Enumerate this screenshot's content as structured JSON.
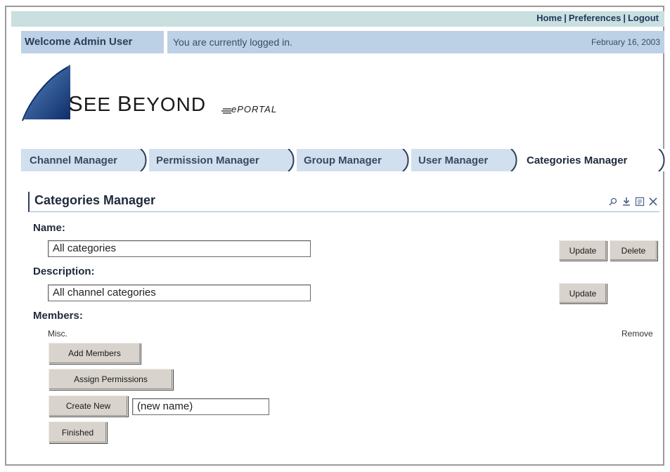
{
  "header": {
    "links": [
      "Home",
      "Preferences",
      "Logout"
    ],
    "separator": "|",
    "welcome": "Welcome Admin User",
    "status": "You are currently logged in.",
    "date": "February 16, 2003"
  },
  "logo": {
    "brand_first": "S",
    "brand_rest1": "EE ",
    "brand_b": "B",
    "brand_rest2": "EYOND",
    "product": "ePORTAL"
  },
  "tabs": [
    {
      "label": "Channel Manager"
    },
    {
      "label": "Permission Manager"
    },
    {
      "label": "Group Manager"
    },
    {
      "label": "User Manager"
    },
    {
      "label": "Categories Manager",
      "active": true
    }
  ],
  "panel": {
    "title": "Categories Manager",
    "icons": [
      "search-icon",
      "download-icon",
      "form-icon",
      "close-icon"
    ],
    "name_label": "Name:",
    "name_value": "All categories",
    "description_label": "Description:",
    "description_value": "All channel categories",
    "members_label": "Members:",
    "member_item": "Misc.",
    "remove_label": "Remove",
    "update_label": "Update",
    "delete_label": "Delete",
    "add_members_label": "Add Members",
    "assign_permissions_label": "Assign Permissions",
    "create_new_label": "Create New",
    "new_name_value": "(new name)",
    "finished_label": "Finished"
  },
  "colors": {
    "topbar": "#c9dfe0",
    "welcome_bg": "#bcd0e6",
    "tabs_bg": "#d2dfee",
    "text_dark": "#1e2a3a"
  }
}
